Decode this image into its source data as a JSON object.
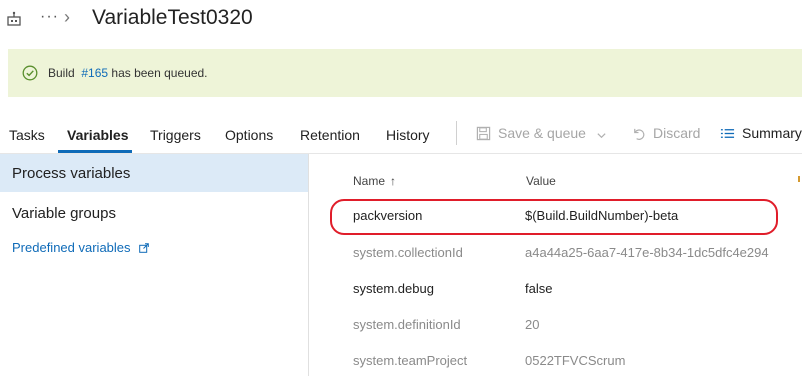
{
  "header": {
    "title": "VariableTest0320",
    "ellipsis": "···",
    "chevron": "›"
  },
  "banner": {
    "prefix": "Build",
    "link": "#165",
    "suffix": "has been queued."
  },
  "tabs": [
    {
      "label": "Tasks"
    },
    {
      "label": "Variables"
    },
    {
      "label": "Triggers"
    },
    {
      "label": "Options"
    },
    {
      "label": "Retention"
    },
    {
      "label": "History"
    }
  ],
  "toolbar": {
    "save_queue": "Save & queue",
    "discard": "Discard",
    "summary": "Summary"
  },
  "left_nav": {
    "process_variables": "Process variables",
    "variable_groups": "Variable groups",
    "predefined_variables": "Predefined variables"
  },
  "grid": {
    "columns": {
      "name": "Name",
      "value": "Value",
      "sort_arrow": "↑"
    },
    "rows": [
      {
        "name": "packversion",
        "value": "$(Build.BuildNumber)-beta"
      },
      {
        "name": "system.collectionId",
        "value": "a4a44a25-6aa7-417e-8b34-1dc5dfc4e294"
      },
      {
        "name": "system.debug",
        "value": "false"
      },
      {
        "name": "system.definitionId",
        "value": "20"
      },
      {
        "name": "system.teamProject",
        "value": "0522TFVCScrum"
      }
    ]
  },
  "colors": {
    "accent": "#0f6bb8",
    "banner_bg": "#eef4d8",
    "selected_nav_bg": "#dceaf7",
    "highlight_outline": "#e01d2a"
  }
}
